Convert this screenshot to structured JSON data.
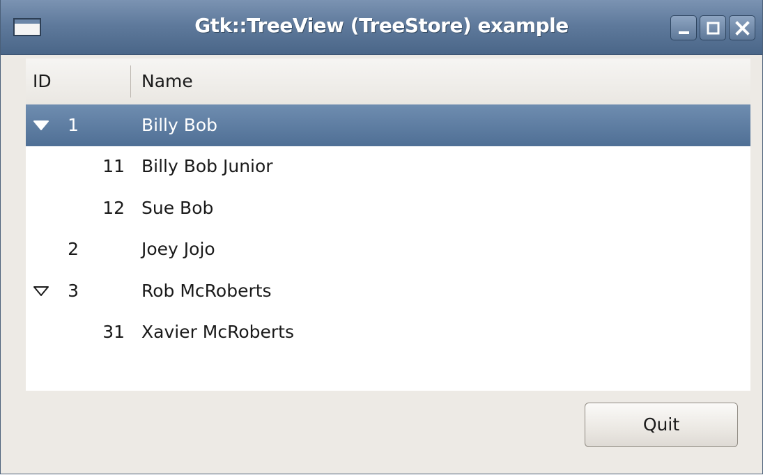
{
  "window": {
    "title": "Gtk::TreeView (TreeStore) example"
  },
  "tree": {
    "columns": [
      "ID",
      "Name"
    ],
    "rows": [
      {
        "id": "1",
        "name": "Billy Bob",
        "level": 0,
        "expander": "expanded",
        "selected": true
      },
      {
        "id": "11",
        "name": "Billy Bob Junior",
        "level": 1,
        "expander": "none",
        "selected": false
      },
      {
        "id": "12",
        "name": "Sue Bob",
        "level": 1,
        "expander": "none",
        "selected": false
      },
      {
        "id": "2",
        "name": "Joey Jojo",
        "level": 0,
        "expander": "none",
        "selected": false
      },
      {
        "id": "3",
        "name": "Rob McRoberts",
        "level": 0,
        "expander": "expanded",
        "selected": false
      },
      {
        "id": "31",
        "name": "Xavier McRoberts",
        "level": 1,
        "expander": "none",
        "selected": false
      }
    ]
  },
  "buttons": {
    "quit_label": "Quit"
  },
  "colors": {
    "titlebar": "#5f7a9c",
    "selection": "#5a7aa0",
    "window_bg": "#edeae5"
  },
  "icons": {
    "window_menu": "window-icon",
    "minimize": "minimize-icon",
    "maximize": "maximize-icon",
    "close": "close-icon",
    "expander": "triangle-down-icon"
  }
}
